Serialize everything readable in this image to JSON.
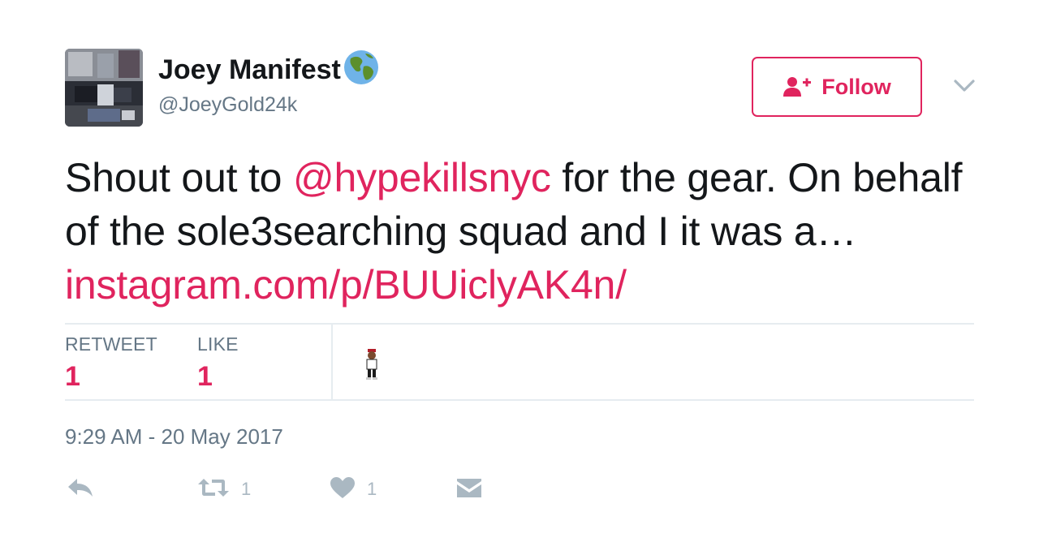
{
  "user": {
    "display_name": "Joey Manifest",
    "handle": "@JoeyGold24k",
    "name_emoji": "globe-emoji"
  },
  "follow_button": {
    "label": "Follow",
    "icon": "add-person-icon"
  },
  "tweet": {
    "text_before": "Shout out to ",
    "mention": "@hypekillsnyc",
    "text_after": " for the gear. On behalf of the sole3searching squad and I it was a… ",
    "link": "instagram.com/p/BUUiclyAK4n/"
  },
  "stats": {
    "retweet_label": "RETWEET",
    "retweet_count": "1",
    "like_label": "LIKE",
    "like_count": "1"
  },
  "timestamp": "9:29 AM - 20 May 2017",
  "actions": {
    "reply_icon": "reply-icon",
    "retweet_icon": "retweet-icon",
    "retweet_count": "1",
    "like_icon": "heart-icon",
    "like_count": "1",
    "dm_icon": "envelope-icon"
  },
  "colors": {
    "accent": "#e0245e",
    "secondary_text": "#657786",
    "action_icons": "#aab8c2",
    "border": "#e6ecf0"
  }
}
